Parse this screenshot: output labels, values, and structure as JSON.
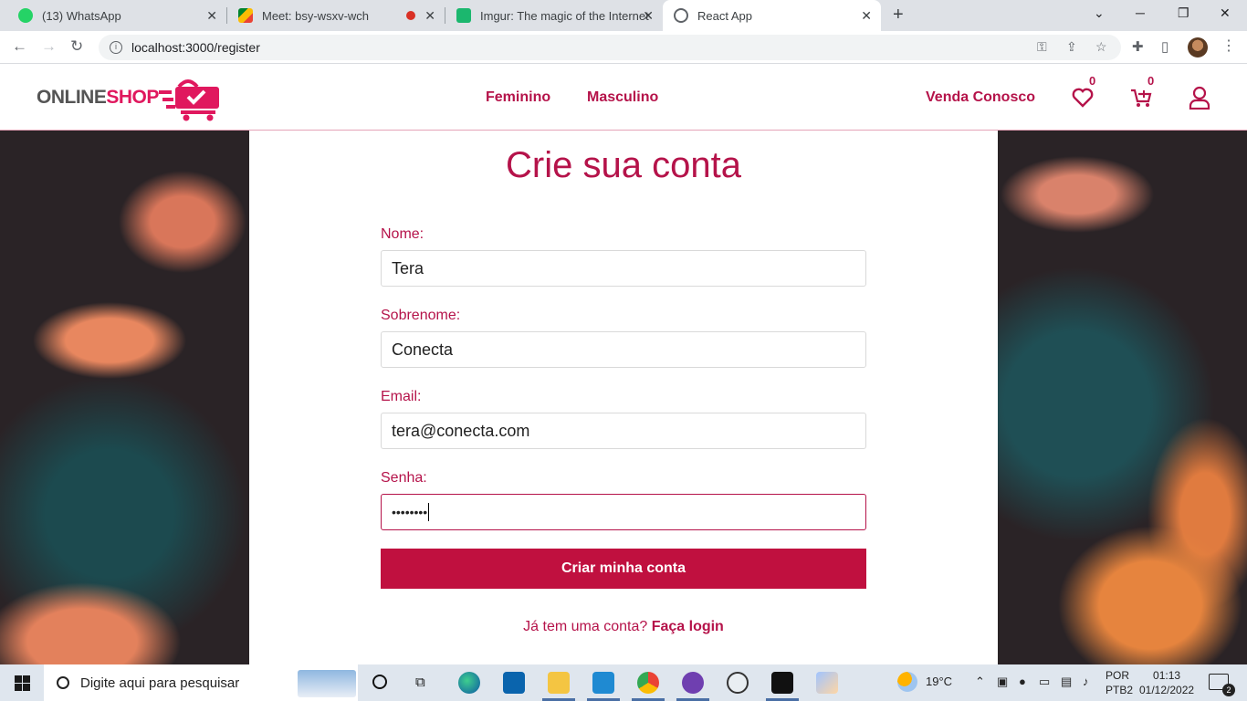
{
  "browser": {
    "tabs": [
      {
        "title": "(13) WhatsApp",
        "badge": "13"
      },
      {
        "title": "Meet: bsy-wsxv-wch"
      },
      {
        "title": "Imgur: The magic of the Internet"
      },
      {
        "title": "React App"
      }
    ],
    "url": "localhost:3000/register"
  },
  "site": {
    "logo_part1": "ONLINE",
    "logo_part2": "SHOP",
    "nav": [
      "Feminino",
      "Masculino"
    ],
    "sell": "Venda Conosco",
    "favorites_count": "0",
    "cart_count": "0",
    "colors": {
      "accent": "#b5134a",
      "button": "#c0103f",
      "logo": "#e0185e"
    }
  },
  "form": {
    "title": "Crie sua conta",
    "fields": [
      {
        "label": "Nome:",
        "value": "Tera"
      },
      {
        "label": "Sobrenome:",
        "value": "Conecta"
      },
      {
        "label": "Email:",
        "value": "tera@conecta.com"
      },
      {
        "label": "Senha:",
        "value": "••••••••"
      }
    ],
    "submit": "Criar minha conta",
    "login_prompt": "Já tem uma conta?",
    "login_link": "Faça login"
  },
  "taskbar": {
    "search_placeholder": "Digite aqui para pesquisar",
    "weather": "19°C",
    "lang1": "POR",
    "lang2": "PTB2",
    "time": "01:13",
    "date": "01/12/2022",
    "notifications": "2"
  }
}
